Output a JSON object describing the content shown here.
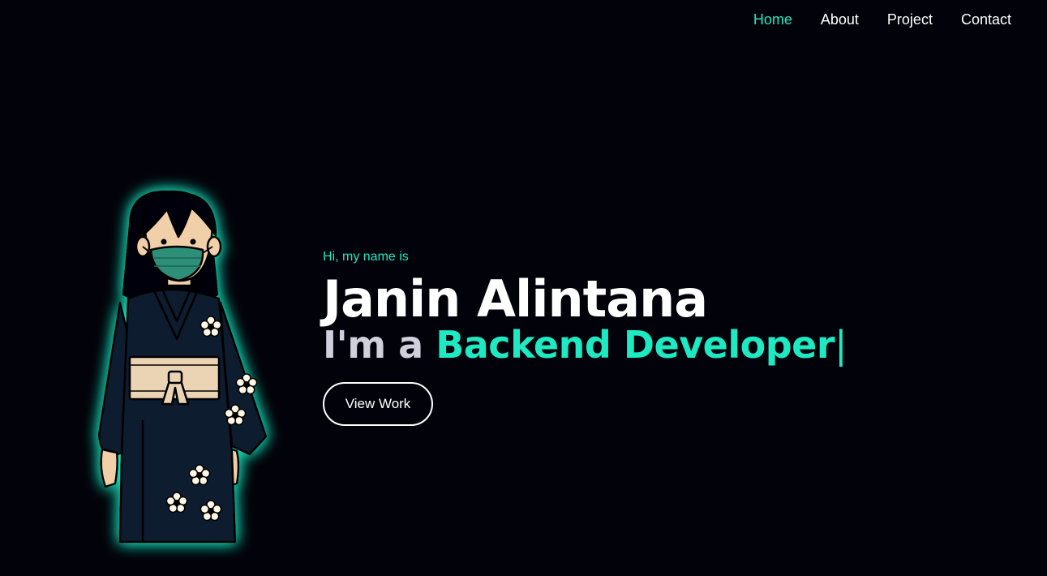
{
  "nav": {
    "items": [
      {
        "label": "Home",
        "active": true
      },
      {
        "label": "About",
        "active": false
      },
      {
        "label": "Project",
        "active": false
      },
      {
        "label": "Contact",
        "active": false
      }
    ]
  },
  "hero": {
    "greeting": "Hi, my name is",
    "name": "Janin Alintana",
    "role_prefix": "I'm a",
    "role_text": "Backend Developer",
    "cursor": "|",
    "button_label": "View Work"
  },
  "avatar": {
    "icon": "kimono-girl-avatar"
  },
  "colors": {
    "background": "#02030a",
    "accent": "#1de9c2",
    "text": "#ffffff",
    "muted": "#cfd0dc"
  }
}
